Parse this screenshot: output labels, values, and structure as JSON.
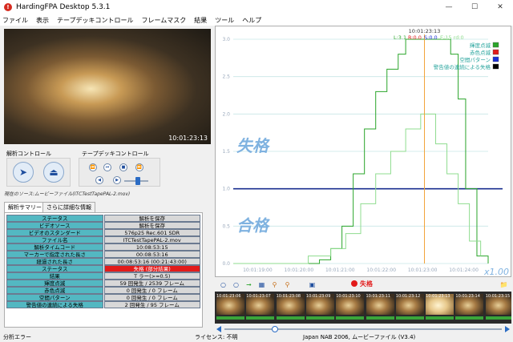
{
  "window": {
    "title": "HardingFPA Desktop 5.3.1",
    "icon": "app-alert-icon",
    "controls": [
      "minimize-icon",
      "maximize-icon",
      "close-icon"
    ]
  },
  "menu": [
    "ファイル",
    "表示",
    "テープデッキコントロール",
    "フレームマスク",
    "結果",
    "ツール",
    "ヘルプ"
  ],
  "video": {
    "timecode": "10:01:23:13"
  },
  "analysis_control": {
    "title": "解析コントロール"
  },
  "tape_deck": {
    "title": "テープデッキコントロール"
  },
  "source_line": "現在のソース:ムービーファイル(ITCTestTapePAL-2.mov)",
  "tabs": [
    "解析サマリー",
    "さらに詳細な情報"
  ],
  "summary": [
    {
      "key": "ステータス",
      "value": "解析を保存",
      "fail": false
    },
    {
      "key": "ビデオソース",
      "value": "解析を保存",
      "fail": false
    },
    {
      "key": "ビデオのスタンダード",
      "value": "576p25 Rec.601 SDR",
      "fail": false
    },
    {
      "key": "ファイル名",
      "value": "ITCTestTapePAL-2.mov",
      "fail": false
    },
    {
      "key": "解析タイムコード",
      "value": "10:08:53:15",
      "fail": false
    },
    {
      "key": "マーカーで指定された長さ",
      "value": "00:08:53:16",
      "fail": false
    },
    {
      "key": "経過された長さ",
      "value": "00:08:53:16 (00:21:43:00)",
      "fail": false
    },
    {
      "key": "ステータス",
      "value": "失格 (部分結果)",
      "fail": true
    },
    {
      "key": "結果",
      "value": "T ラー(>=0.5)",
      "fail": false
    },
    {
      "key": "輝度点滅",
      "value": "59 回発生 / 2539 フレーム",
      "fail": false
    },
    {
      "key": "赤色点滅",
      "value": "0 回発生 / 0 フレーム",
      "fail": false
    },
    {
      "key": "空間パターン",
      "value": "0 回発生 / 0 フレーム",
      "fail": false
    },
    {
      "key": "警告値の連続による失格",
      "value": "2 回発生 / 95 フレーム",
      "fail": false
    }
  ],
  "status_bar": {
    "left": "分析エラー",
    "middle": "ライセンス: 不明",
    "right": "Japan NAB 2006, ムービーファイル (V3.4)"
  },
  "chart_data": {
    "type": "line",
    "title": "10:01:23:13",
    "readout": {
      "L": "L:3.1",
      "R": "R:0.0",
      "S": "S:0.0",
      "extra": "E:15 rd:0"
    },
    "y_ticks": [
      "3.0",
      "2.5",
      "2.0",
      "1.5",
      "1.0",
      "0.5",
      "0.0"
    ],
    "ylim": [
      0,
      3.0
    ],
    "x_ticks": [
      "10:01:19:00",
      "10:01:20:00",
      "10:01:21:00",
      "10:01:22:00",
      "10:01:23:00",
      "10:01:24:00"
    ],
    "xlim": [
      0,
      6.8
    ],
    "zoom": "x1.00",
    "threshold": 1.0,
    "cursor_x": 5.1,
    "region_labels": {
      "fail": "失格",
      "pass": "合格"
    },
    "legend_position": "top-right",
    "legend": [
      {
        "name": "輝度点滅",
        "color": "#2aa52a"
      },
      {
        "name": "赤色点滅",
        "color": "#e21b1b"
      },
      {
        "name": "空間パターン",
        "color": "#1a2fd6"
      },
      {
        "name": "警告値の連続による失格",
        "color": "#000000"
      }
    ],
    "series": [
      {
        "name": "輝度点滅",
        "color": "#2aa52a",
        "x": [
          0,
          2.0,
          2.3,
          2.6,
          2.9,
          3.2,
          3.5,
          3.8,
          4.1,
          4.4,
          4.6,
          4.8,
          5.2,
          5.6,
          5.8,
          6.0,
          6.2,
          6.5,
          6.8
        ],
        "y": [
          0,
          0,
          0.05,
          0.2,
          0.5,
          1.2,
          1.8,
          2.3,
          2.6,
          2.8,
          3.0,
          3.0,
          3.0,
          3.0,
          2.8,
          2.2,
          1.0,
          0.1,
          0
        ]
      },
      {
        "name": "警告値",
        "color": "#8fdc8f",
        "x": [
          0,
          2.0,
          2.6,
          3.0,
          3.4,
          3.8,
          4.2,
          4.6,
          5.0,
          5.4,
          5.7,
          6.0,
          6.3,
          6.6
        ],
        "y": [
          0,
          0.1,
          0.2,
          0.4,
          0.8,
          1.2,
          1.5,
          1.8,
          2.0,
          1.6,
          1.2,
          0.8,
          0.3,
          0.1
        ]
      }
    ]
  },
  "filmstrip": {
    "frames": [
      "10:01:23:06",
      "10:01:23:07",
      "10:01:23:08",
      "10:01:23:09",
      "10:01:23:10",
      "10:01:23:11",
      "10:01:23:12",
      "10:01:23:13",
      "10:01:23:14",
      "10:01:23:15"
    ],
    "highlight_index": 7,
    "fail_label": "失格"
  }
}
